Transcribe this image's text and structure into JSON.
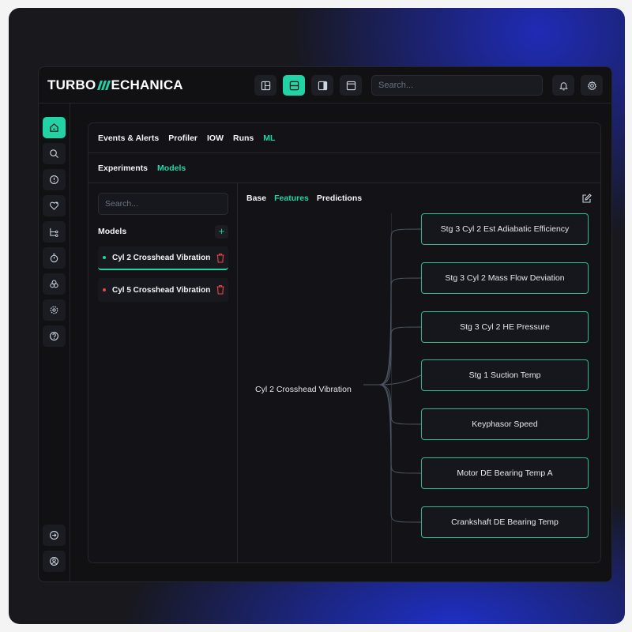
{
  "brand": {
    "name_left": "TURBO",
    "name_right": "ECHANICA"
  },
  "topbar": {
    "search_placeholder": "Search..."
  },
  "main_tabs": [
    "Events & Alerts",
    "Profiler",
    "IOW",
    "Runs",
    "ML"
  ],
  "active_main_tab": "ML",
  "sub_tabs": [
    "Experiments",
    "Models"
  ],
  "active_sub_tab": "Models",
  "models_panel": {
    "search_placeholder": "Search...",
    "heading": "Models",
    "add_label": "+",
    "items": [
      {
        "name": "Cyl 2 Crosshead Vibration",
        "status_color": "#22d3a6",
        "selected": true
      },
      {
        "name": "Cyl 5 Crosshead Vibration",
        "status_color": "#ef4444",
        "selected": false
      }
    ]
  },
  "detail_tabs": [
    "Base",
    "Features",
    "Predictions"
  ],
  "active_detail_tab": "Features",
  "feature_tree": {
    "root": "Cyl 2 Crosshead Vibration",
    "features": [
      "Stg 3 Cyl 2 Est Adiabatic Efficiency",
      "Stg 3 Cyl 2 Mass Flow Deviation",
      "Stg 3 Cyl 2 HE Pressure",
      "Stg 1 Suction Temp",
      "Keyphasor Speed",
      "Motor DE Bearing Temp A",
      "Crankshaft DE Bearing Temp"
    ]
  },
  "colors": {
    "accent": "#22d3a6",
    "danger": "#ef4444",
    "background": "#111114"
  }
}
